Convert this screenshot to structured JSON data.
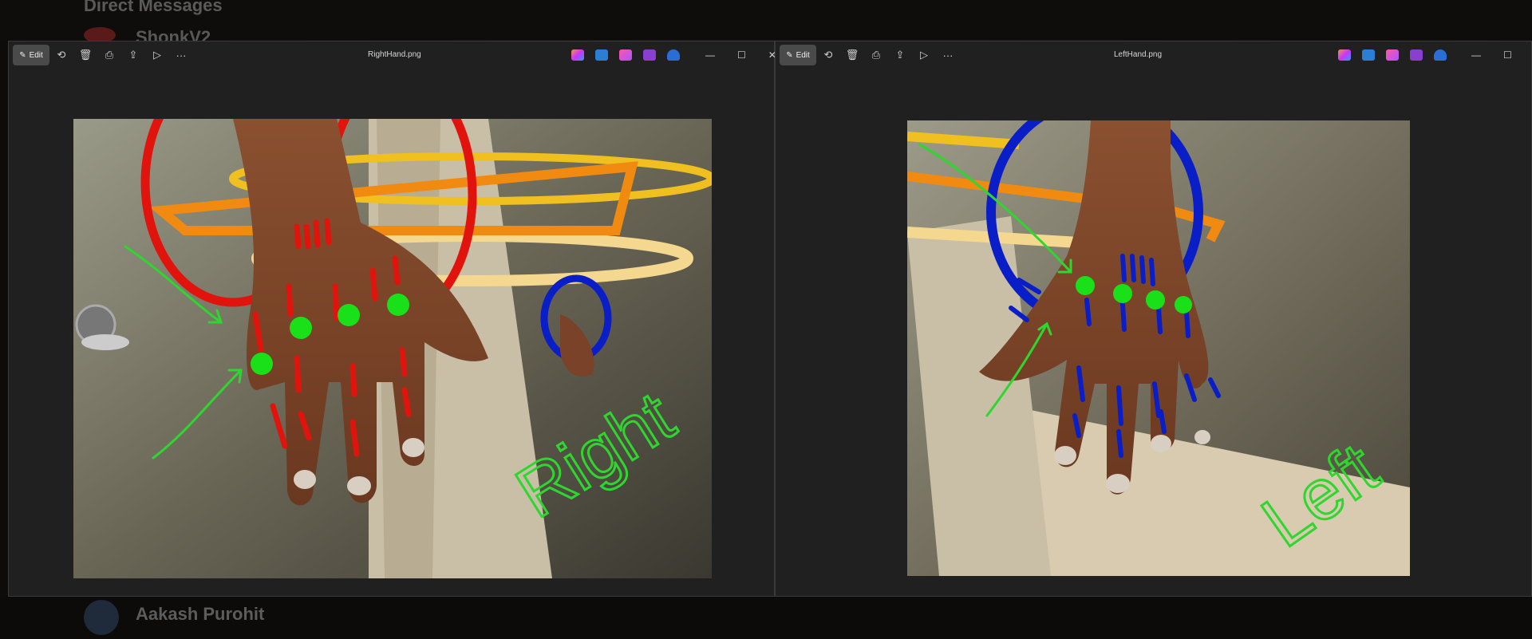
{
  "background": {
    "dm_heading": "Direct Messages",
    "top_user": "ShonkV2",
    "bottom_user": "Aakash Purohit"
  },
  "viewer_left": {
    "edit_label": "Edit",
    "filename": "RightHand.png",
    "annotation_text": "Right"
  },
  "viewer_right": {
    "edit_label": "Edit",
    "filename": "LeftHand.png",
    "annotation_text": "Left"
  },
  "toolbar_icons": [
    "rotate-icon",
    "delete-icon",
    "print-icon",
    "share-icon",
    "slideshow-icon",
    "more-icon"
  ],
  "colors": {
    "red_marker": "#e0140c",
    "blue_marker": "#0a1ec8",
    "green_marker": "#2fd62f",
    "dot_green": "#19e019"
  }
}
